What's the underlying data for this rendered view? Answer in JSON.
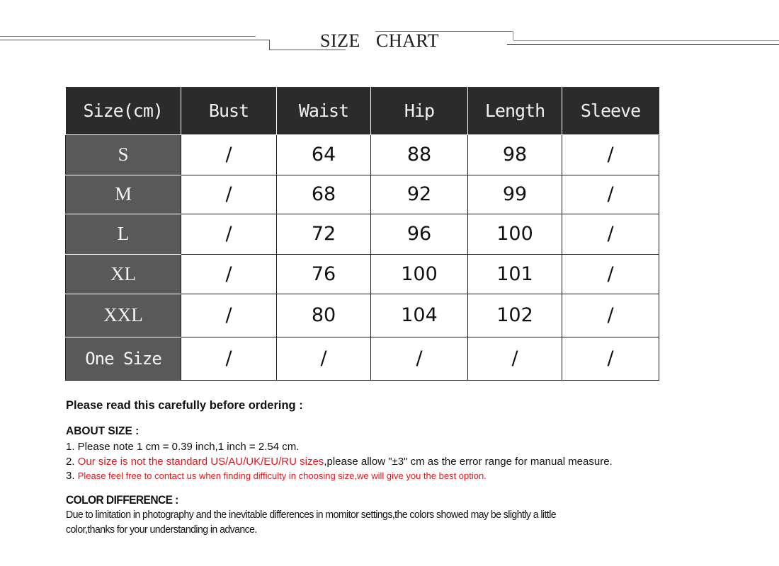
{
  "banner": {
    "title_word_1": "SIZE",
    "title_word_2": "CHART"
  },
  "table": {
    "headers": [
      "Size(cm)",
      "Bust",
      "Waist",
      "Hip",
      "Length",
      "Sleeve"
    ],
    "rows": [
      {
        "size": "S",
        "bust": "/",
        "waist": "64",
        "hip": "88",
        "length": "98",
        "sleeve": "/"
      },
      {
        "size": "M",
        "bust": "/",
        "waist": "68",
        "hip": "92",
        "length": "99",
        "sleeve": "/"
      },
      {
        "size": "L",
        "bust": "/",
        "waist": "72",
        "hip": "96",
        "length": "100",
        "sleeve": "/"
      },
      {
        "size": "XL",
        "bust": "/",
        "waist": "76",
        "hip": "100",
        "length": "101",
        "sleeve": "/"
      },
      {
        "size": "XXL",
        "bust": "/",
        "waist": "80",
        "hip": "104",
        "length": "102",
        "sleeve": "/"
      },
      {
        "size": "One Size",
        "bust": "/",
        "waist": "/",
        "hip": "/",
        "length": "/",
        "sleeve": "/"
      }
    ]
  },
  "notes": {
    "intro": "Please read this carefully before ordering :",
    "about_size": {
      "heading": "ABOUT SIZE :",
      "item1": "1. Please note 1 cm = 0.39 inch,1 inch = 2.54 cm.",
      "item2_num": "2. ",
      "item2_red": "Our size is not the standard US/AU/UK/EU/RU sizes",
      "item2_rest": ",please allow \"±3\" cm as the error range for manual measure.",
      "item3_num": "3. ",
      "item3_red": "Please feel free to contact us when finding difficulty in choosing size,we will give you the best option."
    },
    "color_difference": {
      "heading": "COLOR DIFFERENCE :",
      "line1": "Due to limitation in photography and the inevitable differences in momitor settings,the colors showed may be slightly a little",
      "line2": "color,thanks for your understanding in advance."
    }
  },
  "colors": {
    "header_bg": "#2b2b2b",
    "size_col_bg": "#595959",
    "warning_red": "#e8141a"
  }
}
